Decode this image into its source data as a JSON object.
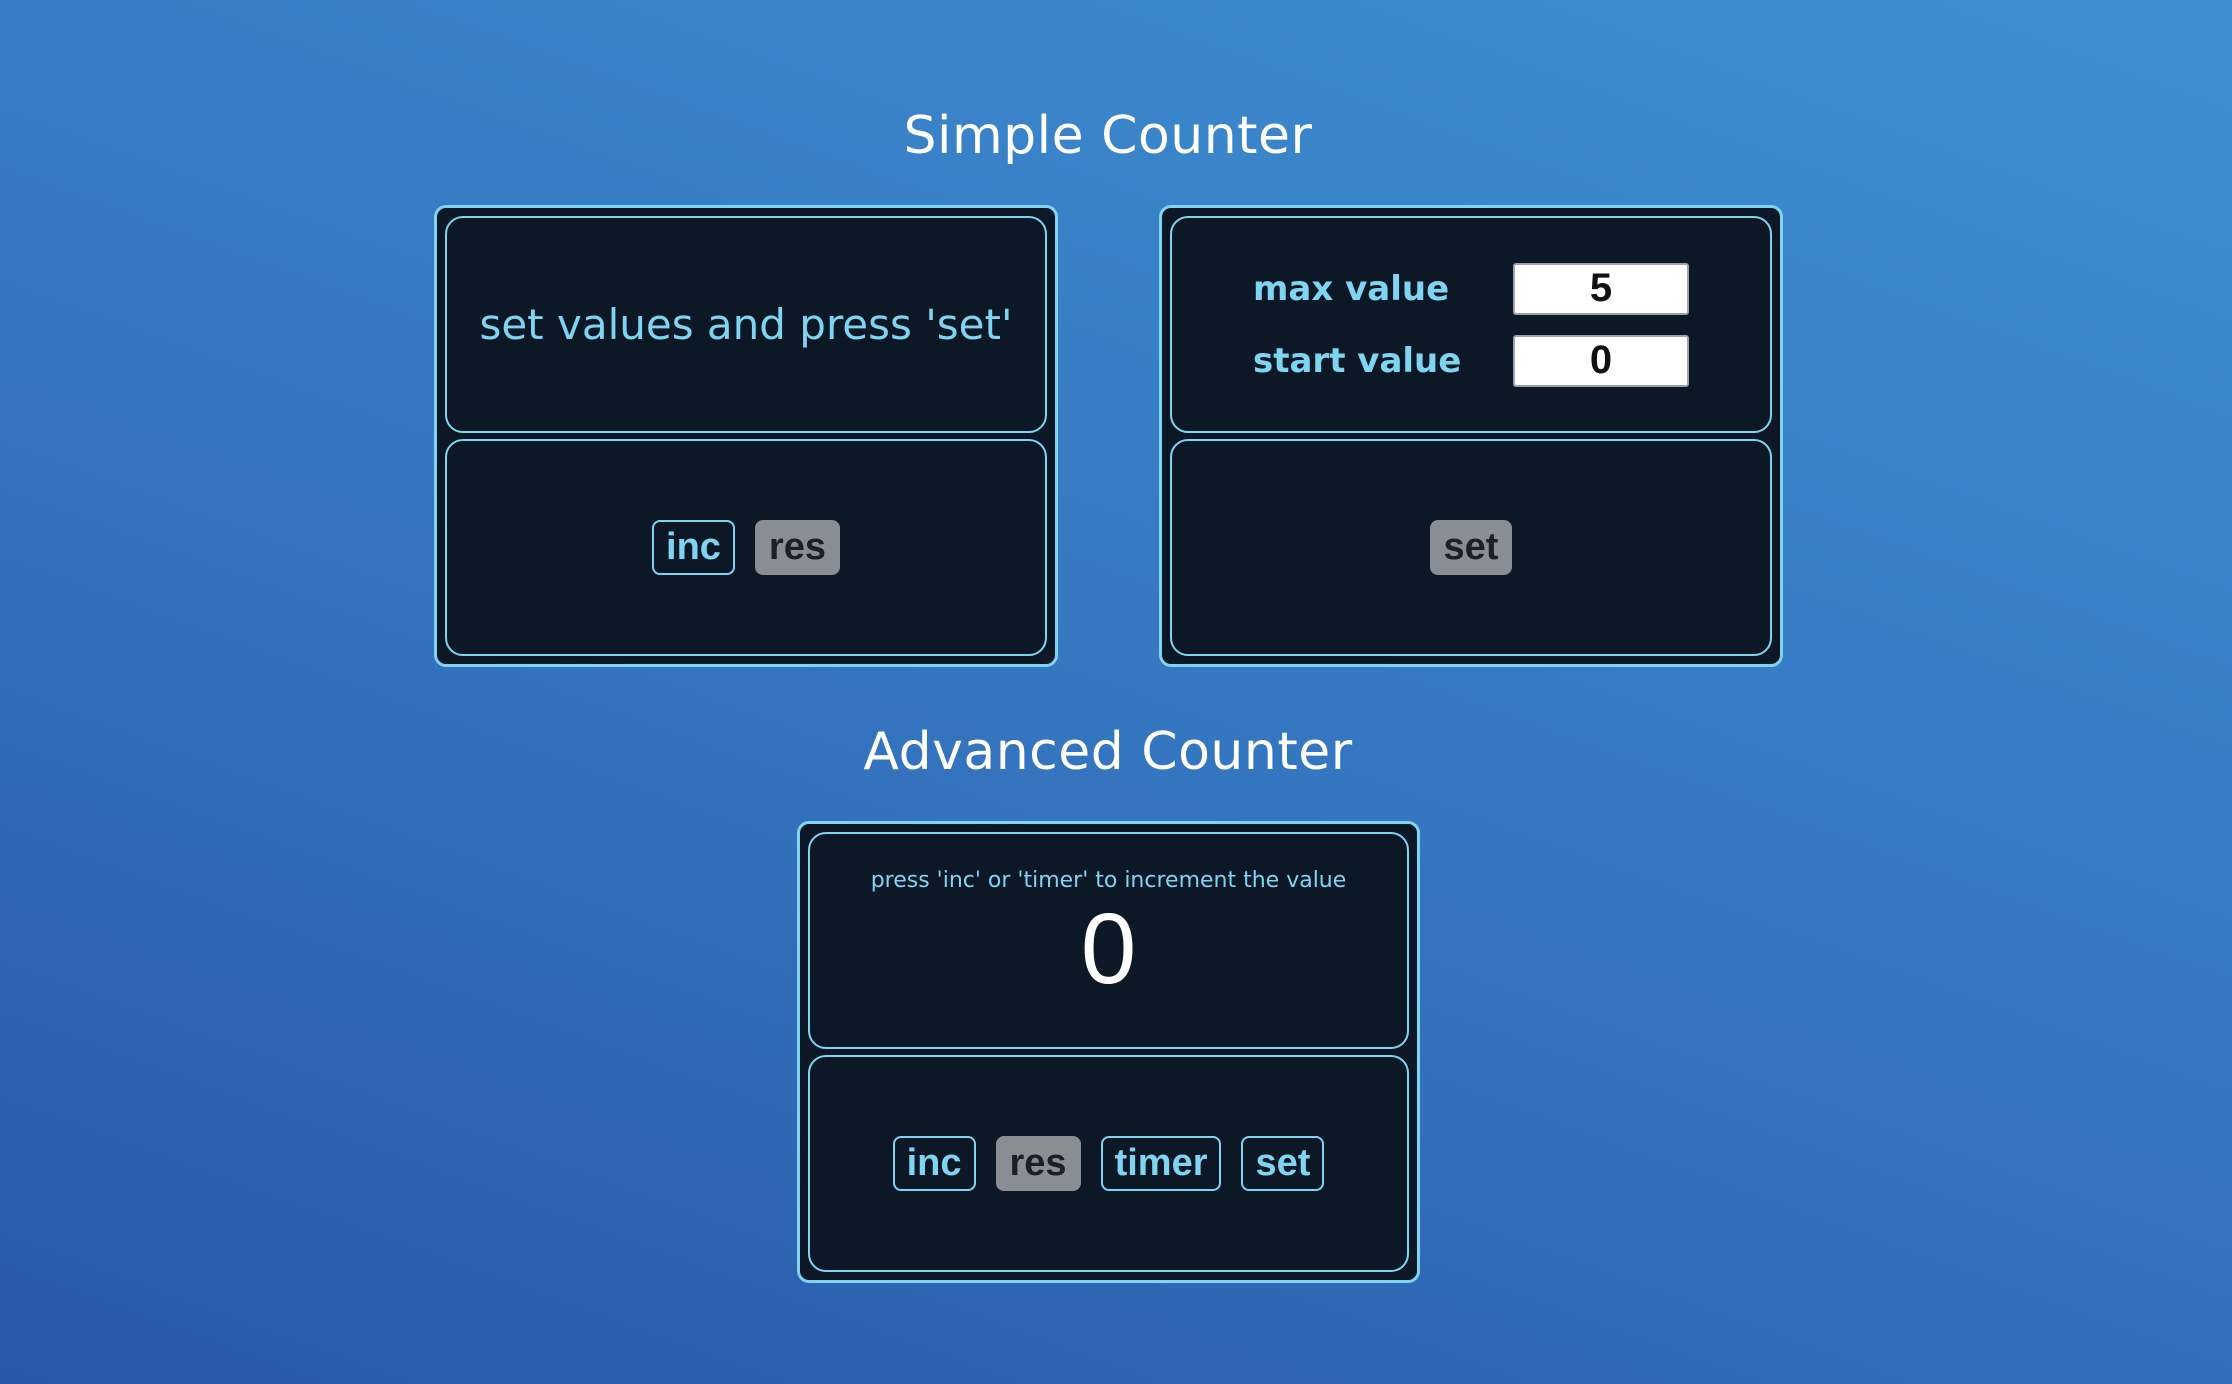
{
  "simple_counter": {
    "title": "Simple Counter",
    "display": {
      "hint": "set values and press 'set'"
    },
    "buttons": {
      "inc_label": "inc",
      "res_label": "res"
    },
    "settings": {
      "max_label": "max value",
      "max_value": "5",
      "start_label": "start value",
      "start_value": "0",
      "set_label": "set"
    }
  },
  "advanced_counter": {
    "title": "Advanced Counter",
    "display": {
      "hint": "press 'inc' or 'timer' to increment the value",
      "value": "0"
    },
    "buttons": {
      "inc_label": "inc",
      "res_label": "res",
      "timer_label": "timer",
      "set_label": "set"
    }
  },
  "colors": {
    "accent": "#7fd4f2",
    "panel_background": "#0d1826",
    "disabled_button": "#8a8d93"
  }
}
